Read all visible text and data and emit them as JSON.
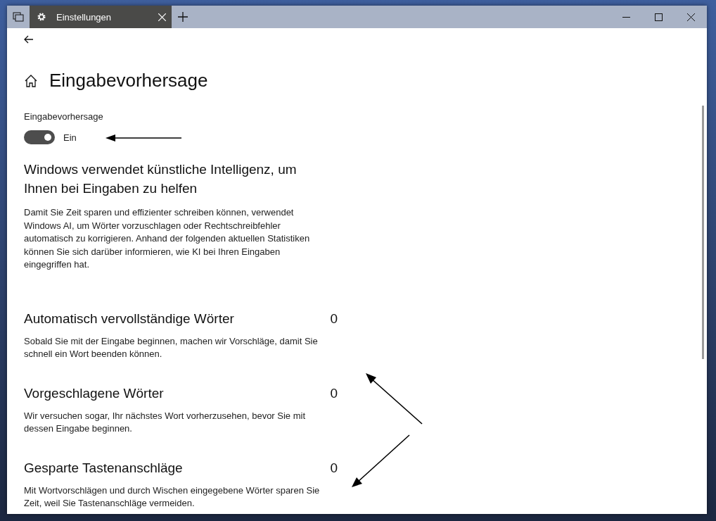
{
  "window": {
    "tabs": [
      {
        "label": "Einstellungen",
        "selected": true
      }
    ]
  },
  "page": {
    "title": "Eingabevorhersage"
  },
  "toggle": {
    "label": "Eingabevorhersage",
    "on": true,
    "state_text": "Ein"
  },
  "intro": {
    "heading": "Windows verwendet künstliche Intelligenz, um Ihnen bei Eingaben zu helfen",
    "text": "Damit Sie Zeit sparen und effizienter schreiben können, verwendet Windows AI, um Wörter vorzuschlagen oder Rechtschreibfehler automatisch zu korrigieren. Anhand der folgenden aktuellen Statistiken können Sie sich darüber informieren, wie KI bei Ihren Eingaben eingegriffen hat."
  },
  "stats": [
    {
      "title": "Automatisch vervollständige Wörter",
      "count": "0",
      "description": "Sobald Sie mit der Eingabe beginnen, machen wir Vorschläge, damit Sie schnell ein Wort beenden können."
    },
    {
      "title": "Vorgeschlagene Wörter",
      "count": "0",
      "description": "Wir versuchen sogar, Ihr nächstes Wort vorherzusehen, bevor Sie mit dessen Eingabe beginnen."
    },
    {
      "title": "Gesparte Tastenanschläge",
      "count": "0",
      "description": "Mit Wortvorschlägen und durch Wischen eingegebene Wörter sparen Sie Zeit, weil Sie Tastenanschläge vermeiden."
    }
  ]
}
